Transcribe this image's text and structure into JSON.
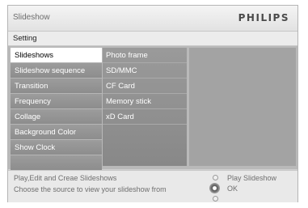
{
  "app": {
    "title": "Slideshow",
    "brand": "PHILIPS"
  },
  "breadcrumb": "Setting",
  "menu": {
    "items": [
      {
        "label": "Slideshows",
        "selected": true
      },
      {
        "label": "Slideshow sequence"
      },
      {
        "label": "Transition"
      },
      {
        "label": "Frequency"
      },
      {
        "label": "Collage"
      },
      {
        "label": "Background Color"
      },
      {
        "label": "Show Clock"
      },
      {
        "label": ""
      }
    ]
  },
  "submenu": {
    "items": [
      {
        "label": "Photo frame"
      },
      {
        "label": "SD/MMC"
      },
      {
        "label": "CF Card"
      },
      {
        "label": "Memory stick"
      },
      {
        "label": "xD Card"
      }
    ]
  },
  "footer": {
    "help_line1": "Play,Edit and Creae Slideshows",
    "help_line2": "Choose the source to view your slideshow from",
    "up_label": "Play Slideshow",
    "ok_label": "OK"
  },
  "icons": {
    "nav_up": "circle-up-icon",
    "nav_knob": "navigation-knob-icon",
    "nav_down": "circle-down-icon"
  }
}
